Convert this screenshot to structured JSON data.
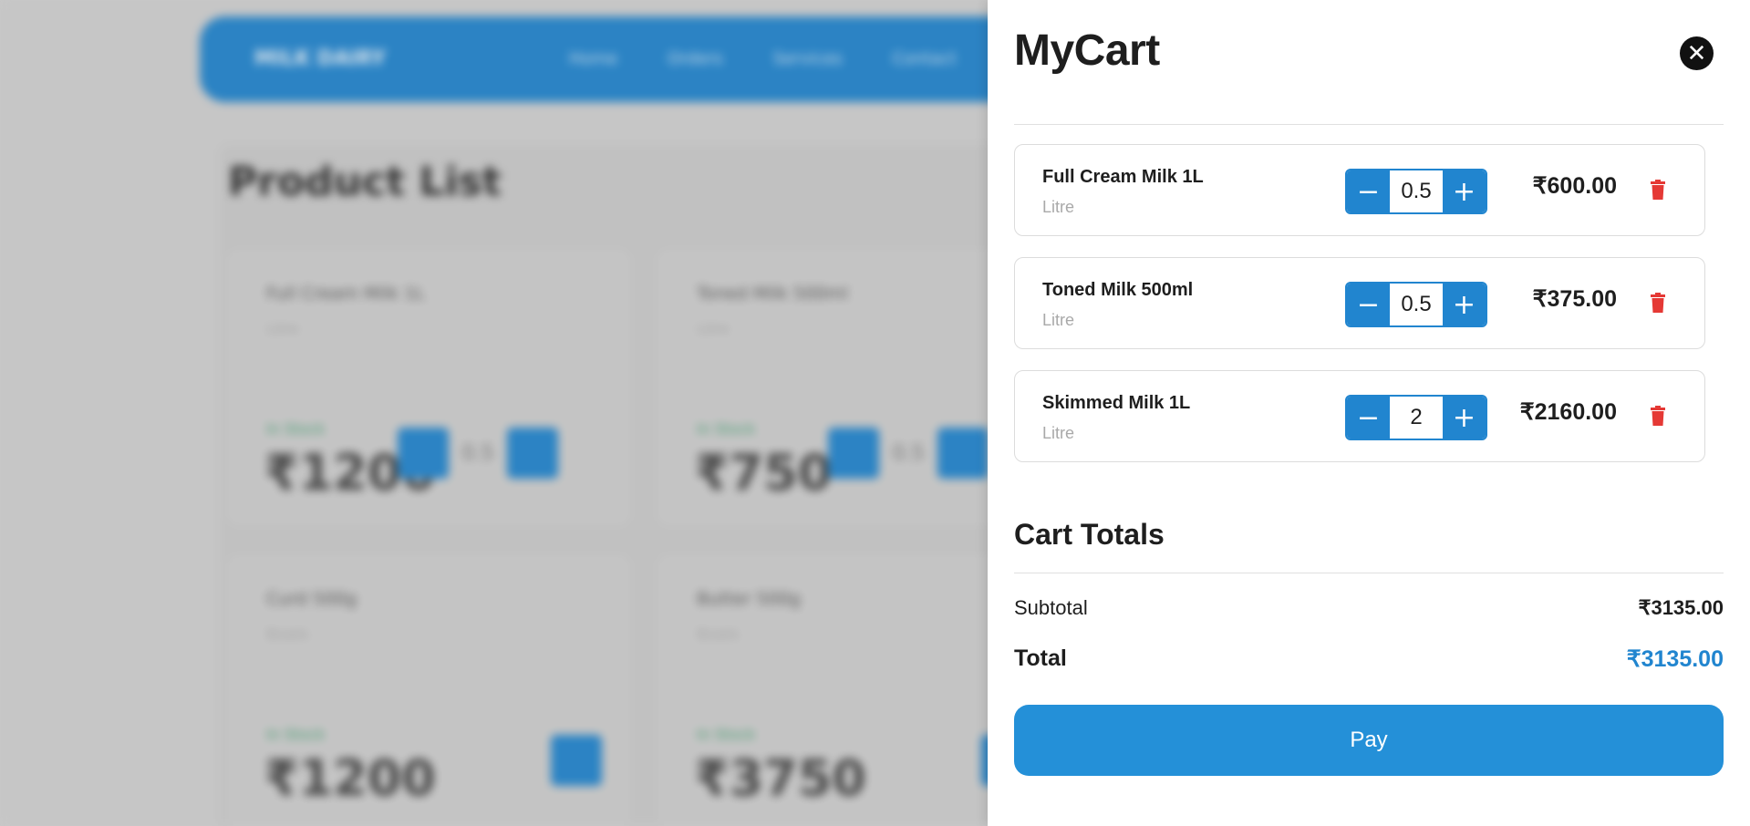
{
  "background": {
    "brand": "MILK DAIRY",
    "nav_links": [
      "Home",
      "Orders",
      "Services",
      "Contact"
    ],
    "section_title": "Product List",
    "cards": [
      {
        "name": "Full Cream Milk 1L",
        "unit": "Litre",
        "stock": "In Stock",
        "price": "₹1200",
        "qty": "0.5"
      },
      {
        "name": "Toned Milk 500ml",
        "unit": "Litre",
        "stock": "In Stock",
        "price": "₹750",
        "qty": "0.5"
      },
      {
        "name": "Curd 500g",
        "unit": "Bowls",
        "stock": "In Stock",
        "price": "₹1200"
      },
      {
        "name": "Butter 500g",
        "unit": "Bowls",
        "stock": "In Stock",
        "price": "₹3750"
      }
    ]
  },
  "cart": {
    "title": "MyCart",
    "close_icon": "close-icon",
    "items": [
      {
        "name": "Full Cream Milk 1L",
        "unit": "Litre",
        "qty": "0.5",
        "price": "₹600.00"
      },
      {
        "name": "Toned Milk 500ml",
        "unit": "Litre",
        "qty": "0.5",
        "price": "₹375.00"
      },
      {
        "name": "Skimmed Milk 1L",
        "unit": "Litre",
        "qty": "2",
        "price": "₹2160.00"
      }
    ],
    "minus_symbol": "−",
    "plus_symbol": "+",
    "totals_title": "Cart Totals",
    "subtotal_label": "Subtotal",
    "subtotal_value": "₹3135.00",
    "total_label": "Total",
    "total_value": "₹3135.00",
    "pay_label": "Pay"
  },
  "colors": {
    "accent": "#2185cf",
    "delete": "#e53935",
    "total_value": "#2185cf"
  }
}
